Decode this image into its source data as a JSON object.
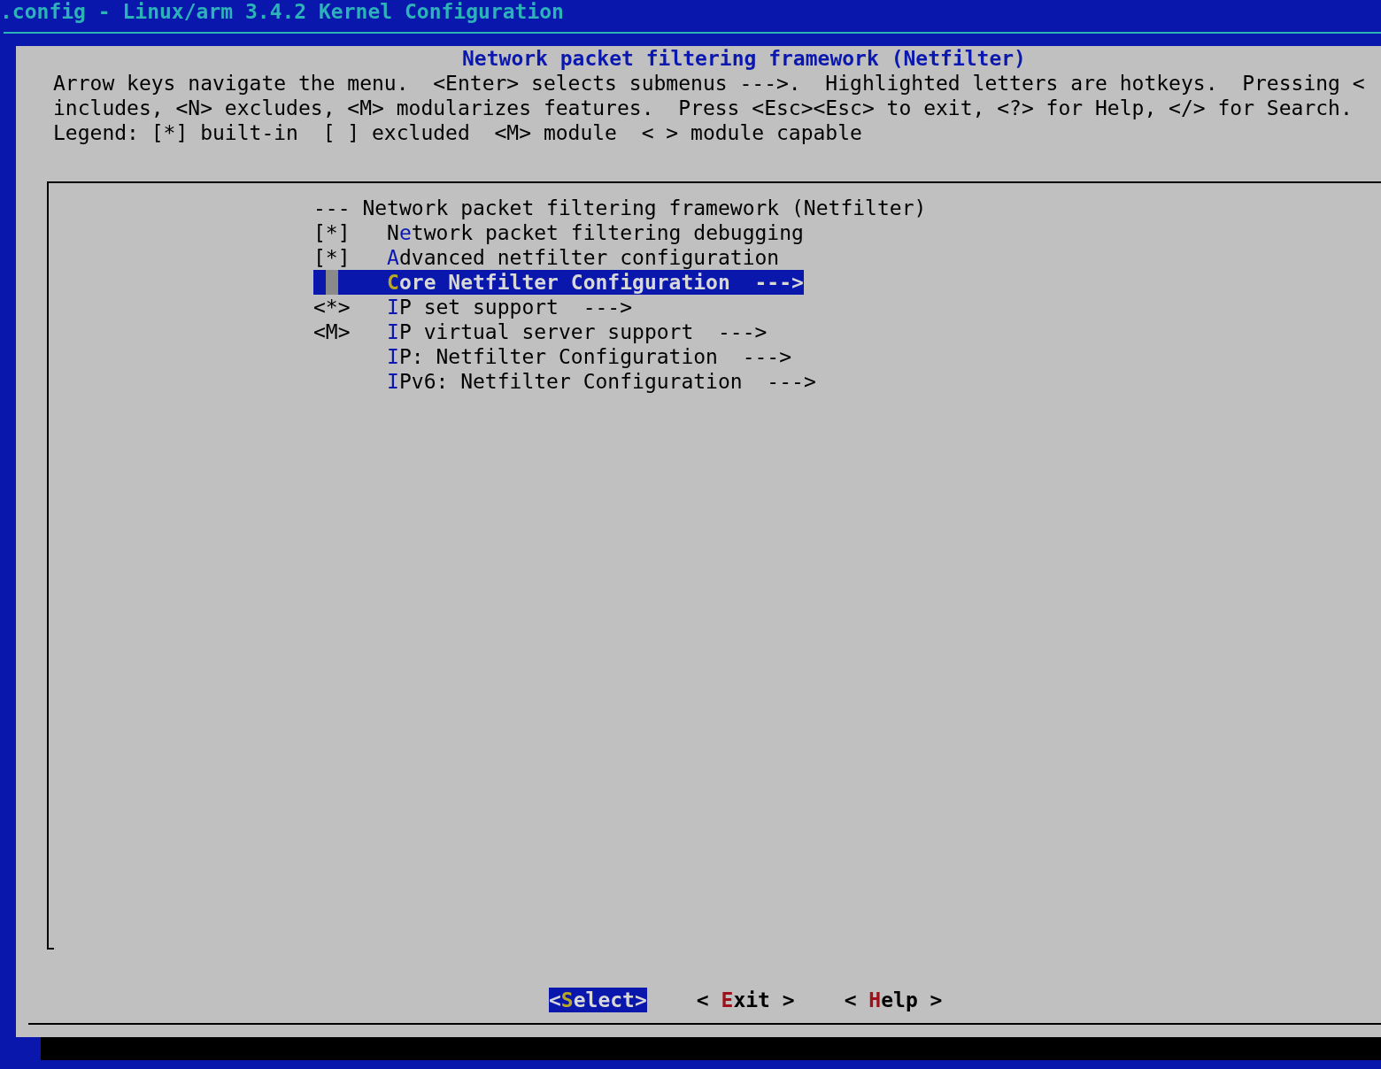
{
  "window": {
    "title": ".config - Linux/arm 3.4.2 Kernel Configuration"
  },
  "dialog": {
    "title": "Network packet filtering framework (Netfilter)",
    "help_lines": [
      "Arrow keys navigate the menu.  <Enter> selects submenus --->.  Highlighted letters are hotkeys.  Pressing <",
      "includes, <N> excludes, <M> modularizes features.  Press <Esc><Esc> to exit, <?> for Help, </> for Search.",
      "Legend: [*] built-in  [ ] excluded  <M> module  < > module capable"
    ]
  },
  "menu": [
    {
      "kind": "heading",
      "state": "---",
      "prefix": "Network packet filtering framework (Netfilter)",
      "selected": false
    },
    {
      "kind": "option",
      "state": "[*]",
      "prefix": "N",
      "hotkey": "e",
      "rest": "twork packet filtering debugging",
      "selected": false
    },
    {
      "kind": "option",
      "state": "[*]",
      "hotkey": "A",
      "rest": "dvanced netfilter configuration",
      "selected": false
    },
    {
      "kind": "option",
      "hotkey": "C",
      "rest": "ore Netfilter Configuration",
      "arrow": "--->",
      "selected": true
    },
    {
      "kind": "option",
      "state": "<*>",
      "hotkey": "I",
      "rest": "P set support",
      "arrow": "--->",
      "selected": false
    },
    {
      "kind": "option",
      "state": "<M>",
      "hotkey": "I",
      "rest": "P virtual server support",
      "arrow": "--->",
      "selected": false
    },
    {
      "kind": "option",
      "hotkey": "I",
      "rest": "P: Netfilter Configuration",
      "arrow": "--->",
      "selected": false
    },
    {
      "kind": "option",
      "hotkey": "I",
      "rest": "Pv6: Netfilter Configuration",
      "arrow": "--->",
      "selected": false
    }
  ],
  "buttons": [
    {
      "open": "<",
      "hotkey": "S",
      "rest": "elect",
      "close": ">",
      "selected": true
    },
    {
      "open": "< ",
      "hotkey": "E",
      "rest": "xit",
      "close": " >",
      "selected": false
    },
    {
      "open": "< ",
      "hotkey": "H",
      "rest": "elp",
      "close": " >",
      "selected": false
    }
  ]
}
